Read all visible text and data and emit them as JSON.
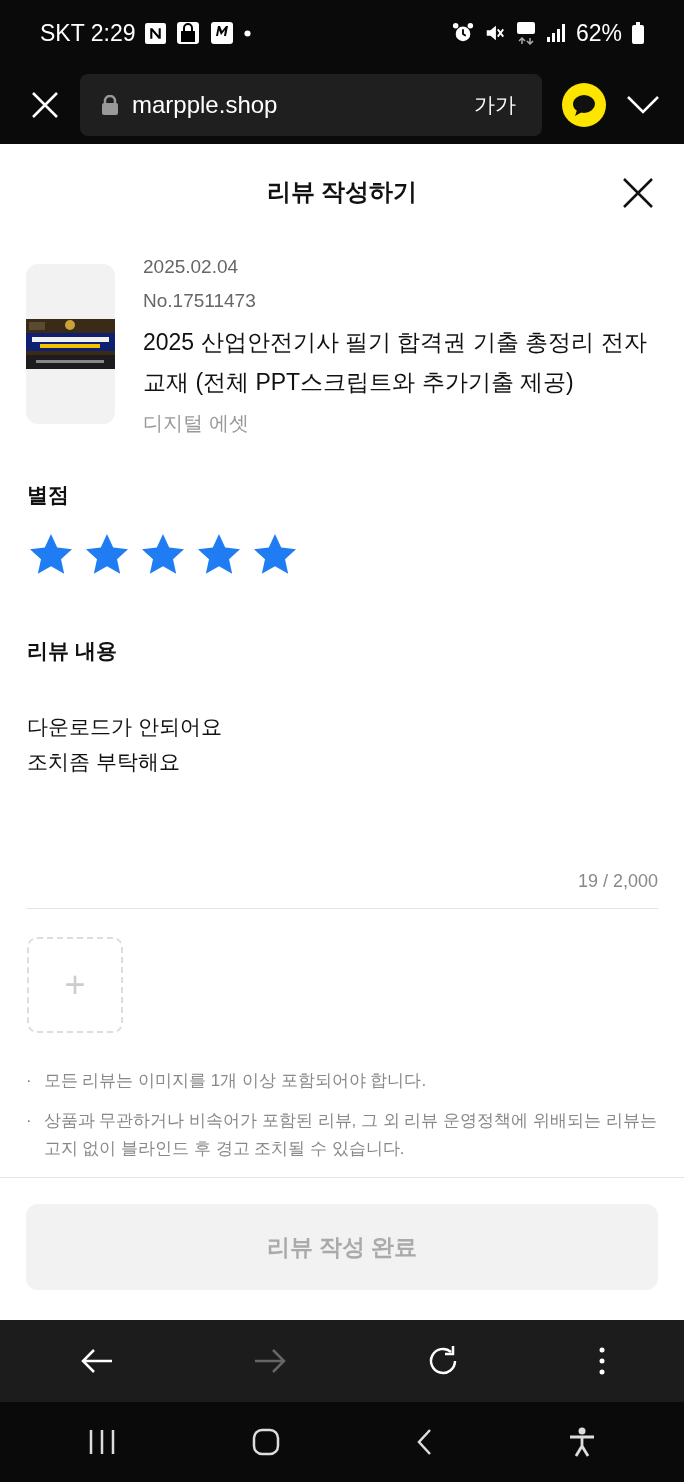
{
  "status_bar": {
    "carrier_time": "SKT 2:29",
    "battery": "62%"
  },
  "browser_bar": {
    "url": "marpple.shop",
    "text_size": "가가"
  },
  "dialog": {
    "title": "리뷰 작성하기"
  },
  "product": {
    "date": "2025.02.04",
    "number": "No.17511473",
    "name": "2025 산업안전기사 필기 합격권 기출 총정리 전자교재 (전체 PPT스크립트와 추가기출 제공)",
    "category": "디지털 에셋"
  },
  "rating": {
    "label": "별점",
    "stars": 5
  },
  "review": {
    "label": "리뷰 내용",
    "value": "다운로드가 안되어요\n조치좀 부탁해요",
    "counter": "19 / 2,000"
  },
  "upload": {
    "icon": "+"
  },
  "notes": [
    {
      "bullet": "·",
      "text": "모든 리뷰는 이미지를 1개 이상 포함되어야 합니다."
    },
    {
      "bullet": "·",
      "text": "상품과 무관하거나 비속어가 포함된 리뷰, 그 외 리뷰 운영정책에 위배되는 리뷰는 고지 없이 블라인드 후 경고 조치될 수 있습니다."
    }
  ],
  "submit_button": {
    "label": "리뷰 작성 완료",
    "disabled": true
  },
  "browser_toolbar": {
    "forward_disabled": true
  }
}
